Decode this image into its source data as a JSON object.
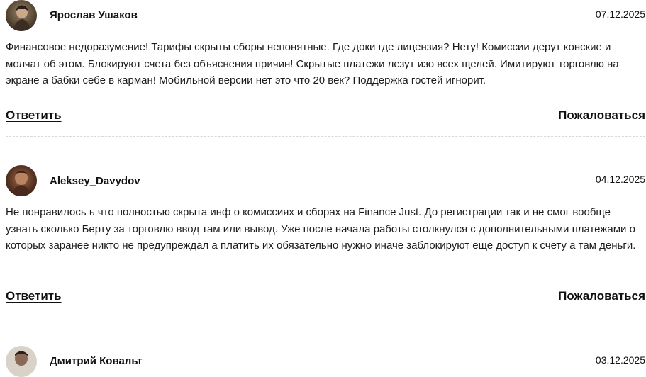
{
  "reviews": [
    {
      "author": "Ярослав Ушаков",
      "date": "07.12.2025",
      "text": "Финансовое недоразумение! Тарифы скрыты сборы непонятные. Где доки где лицензия? Нету! Комиссии дерут конские и молчат об этом. Блокируют счета без объяснения причин! Скрытые платежи лезут изо всех щелей. Имитируют торговлю на экране а бабки себе в карман! Мобильной версии нет это что 20 век? Поддержка гостей игнорит.",
      "reply_label": "Ответить",
      "report_label": "Пожаловаться"
    },
    {
      "author": "Aleksey_Davydov",
      "date": "04.12.2025",
      "text": "Не понравилось ь что полностью скрыта инф о комиссиях и сборах на Finance Just. До регистрации так и не смог вообще узнать сколько Берту за торговлю ввод там или вывод. Уже после начала работы столкнулся с дополнительными платежами о которых заранее никто не предупреждал а платить их обязательно нужно иначе заблокируют еще доступ к счету а там деньги.",
      "reply_label": "Ответить",
      "report_label": "Пожаловаться"
    },
    {
      "author": "Дмитрий Ковальт",
      "date": "03.12.2025"
    }
  ]
}
